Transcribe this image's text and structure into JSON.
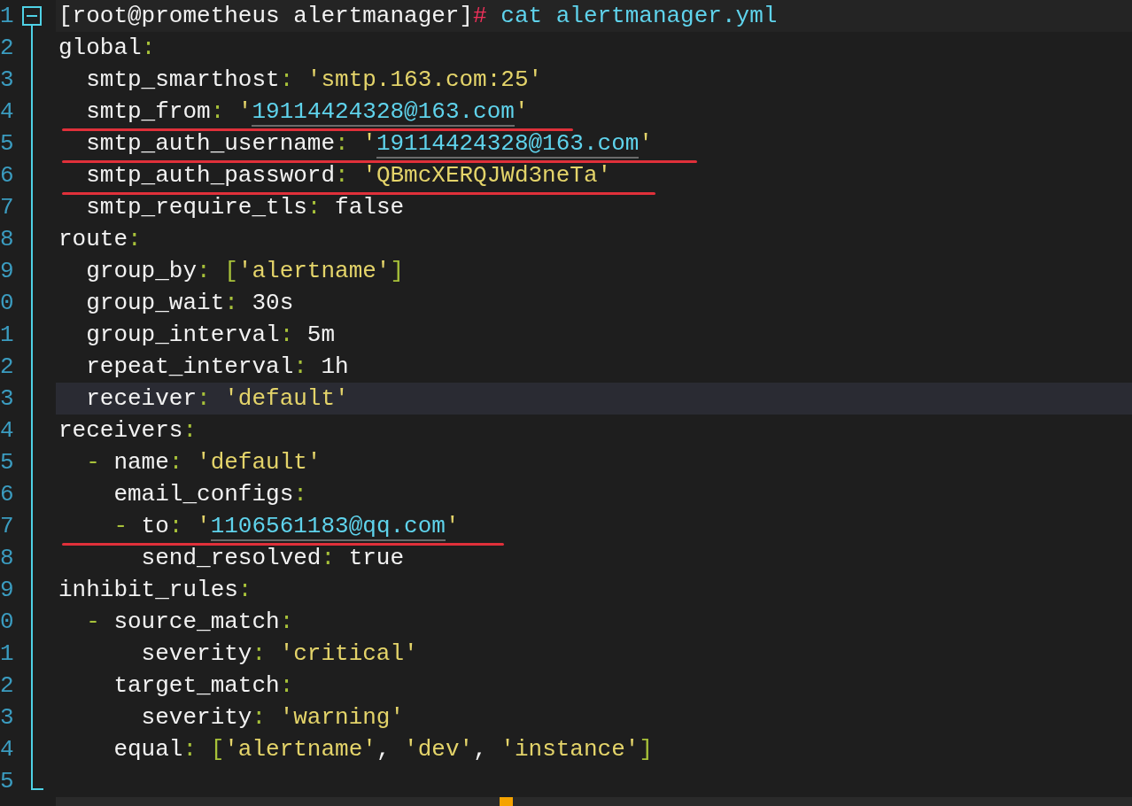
{
  "editor": {
    "lines": [
      {
        "number": "1",
        "highlighted": false,
        "underlined": false,
        "tokens": [
          {
            "kind": "text",
            "text": "[root@prometheus alertmanager]"
          },
          {
            "kind": "hash",
            "text": "#"
          },
          {
            "kind": "cmd",
            "text": " cat alertmanager.yml"
          }
        ]
      },
      {
        "number": "2",
        "highlighted": false,
        "underlined": false,
        "tokens": [
          {
            "kind": "text",
            "text": "global"
          },
          {
            "kind": "punct",
            "text": ":"
          }
        ]
      },
      {
        "number": "3",
        "highlighted": false,
        "underlined": false,
        "tokens": [
          {
            "kind": "text",
            "text": "  smtp_smarthost"
          },
          {
            "kind": "punct",
            "text": ":"
          },
          {
            "kind": "string",
            "text": " 'smtp.163.com:25'"
          }
        ]
      },
      {
        "number": "4",
        "highlighted": false,
        "underlined": true,
        "tokens": [
          {
            "kind": "text",
            "text": "  smtp_from"
          },
          {
            "kind": "punct",
            "text": ":"
          },
          {
            "kind": "string",
            "text": " '"
          },
          {
            "kind": "link",
            "text": "19114424328@163.com"
          },
          {
            "kind": "string",
            "text": "'"
          }
        ]
      },
      {
        "number": "5",
        "highlighted": false,
        "underlined": true,
        "tokens": [
          {
            "kind": "text",
            "text": "  smtp_auth_username"
          },
          {
            "kind": "punct",
            "text": ":"
          },
          {
            "kind": "string",
            "text": " '"
          },
          {
            "kind": "link",
            "text": "19114424328@163.com"
          },
          {
            "kind": "string",
            "text": "'"
          }
        ]
      },
      {
        "number": "6",
        "highlighted": false,
        "underlined": true,
        "tokens": [
          {
            "kind": "text",
            "text": "  smtp_auth_password"
          },
          {
            "kind": "punct",
            "text": ":"
          },
          {
            "kind": "string",
            "text": " 'QBmcXERQJWd3neTa'"
          }
        ]
      },
      {
        "number": "7",
        "highlighted": false,
        "underlined": false,
        "tokens": [
          {
            "kind": "text",
            "text": "  smtp_require_tls"
          },
          {
            "kind": "punct",
            "text": ":"
          },
          {
            "kind": "text",
            "text": " false"
          }
        ]
      },
      {
        "number": "8",
        "highlighted": false,
        "underlined": false,
        "tokens": [
          {
            "kind": "text",
            "text": "route"
          },
          {
            "kind": "punct",
            "text": ":"
          }
        ]
      },
      {
        "number": "9",
        "highlighted": false,
        "underlined": false,
        "tokens": [
          {
            "kind": "text",
            "text": "  group_by"
          },
          {
            "kind": "punct",
            "text": ": ["
          },
          {
            "kind": "string",
            "text": "'alertname'"
          },
          {
            "kind": "punct",
            "text": "]"
          }
        ]
      },
      {
        "number": "0",
        "highlighted": false,
        "underlined": false,
        "tokens": [
          {
            "kind": "text",
            "text": "  group_wait"
          },
          {
            "kind": "punct",
            "text": ":"
          },
          {
            "kind": "text",
            "text": " 30s"
          }
        ]
      },
      {
        "number": "1",
        "highlighted": false,
        "underlined": false,
        "tokens": [
          {
            "kind": "text",
            "text": "  group_interval"
          },
          {
            "kind": "punct",
            "text": ":"
          },
          {
            "kind": "text",
            "text": " 5m"
          }
        ]
      },
      {
        "number": "2",
        "highlighted": false,
        "underlined": false,
        "tokens": [
          {
            "kind": "text",
            "text": "  repeat_interval"
          },
          {
            "kind": "punct",
            "text": ":"
          },
          {
            "kind": "text",
            "text": " 1h"
          }
        ]
      },
      {
        "number": "3",
        "highlighted": true,
        "underlined": false,
        "tokens": [
          {
            "kind": "text",
            "text": "  receiver"
          },
          {
            "kind": "punct",
            "text": ":"
          },
          {
            "kind": "string",
            "text": " 'default'"
          }
        ]
      },
      {
        "number": "4",
        "highlighted": false,
        "underlined": false,
        "tokens": [
          {
            "kind": "text",
            "text": "receivers"
          },
          {
            "kind": "punct",
            "text": ":"
          }
        ]
      },
      {
        "number": "5",
        "highlighted": false,
        "underlined": false,
        "tokens": [
          {
            "kind": "punct",
            "text": "  -"
          },
          {
            "kind": "text",
            "text": " name"
          },
          {
            "kind": "punct",
            "text": ":"
          },
          {
            "kind": "string",
            "text": " 'default'"
          }
        ]
      },
      {
        "number": "6",
        "highlighted": false,
        "underlined": false,
        "tokens": [
          {
            "kind": "text",
            "text": "    email_configs"
          },
          {
            "kind": "punct",
            "text": ":"
          }
        ]
      },
      {
        "number": "7",
        "highlighted": false,
        "underlined": true,
        "tokens": [
          {
            "kind": "punct",
            "text": "    -"
          },
          {
            "kind": "text",
            "text": " to"
          },
          {
            "kind": "punct",
            "text": ":"
          },
          {
            "kind": "string",
            "text": " '"
          },
          {
            "kind": "link",
            "text": "1106561183@qq.com"
          },
          {
            "kind": "string",
            "text": "'"
          }
        ]
      },
      {
        "number": "8",
        "highlighted": false,
        "underlined": false,
        "tokens": [
          {
            "kind": "text",
            "text": "      send_resolved"
          },
          {
            "kind": "punct",
            "text": ":"
          },
          {
            "kind": "text",
            "text": " true"
          }
        ]
      },
      {
        "number": "9",
        "highlighted": false,
        "underlined": false,
        "tokens": [
          {
            "kind": "text",
            "text": "inhibit_rules"
          },
          {
            "kind": "punct",
            "text": ":"
          }
        ]
      },
      {
        "number": "0",
        "highlighted": false,
        "underlined": false,
        "tokens": [
          {
            "kind": "punct",
            "text": "  -"
          },
          {
            "kind": "text",
            "text": " source_match"
          },
          {
            "kind": "punct",
            "text": ":"
          }
        ]
      },
      {
        "number": "1",
        "highlighted": false,
        "underlined": false,
        "tokens": [
          {
            "kind": "text",
            "text": "      severity"
          },
          {
            "kind": "punct",
            "text": ":"
          },
          {
            "kind": "string",
            "text": " 'critical'"
          }
        ]
      },
      {
        "number": "2",
        "highlighted": false,
        "underlined": false,
        "tokens": [
          {
            "kind": "text",
            "text": "    target_match"
          },
          {
            "kind": "punct",
            "text": ":"
          }
        ]
      },
      {
        "number": "3",
        "highlighted": false,
        "underlined": false,
        "tokens": [
          {
            "kind": "text",
            "text": "      severity"
          },
          {
            "kind": "punct",
            "text": ":"
          },
          {
            "kind": "string",
            "text": " 'warning'"
          }
        ]
      },
      {
        "number": "4",
        "highlighted": false,
        "underlined": false,
        "tokens": [
          {
            "kind": "text",
            "text": "    equal"
          },
          {
            "kind": "punct",
            "text": ": ["
          },
          {
            "kind": "string",
            "text": "'alertname'"
          },
          {
            "kind": "text",
            "text": ", "
          },
          {
            "kind": "string",
            "text": "'dev'"
          },
          {
            "kind": "text",
            "text": ", "
          },
          {
            "kind": "string",
            "text": "'instance'"
          },
          {
            "kind": "punct",
            "text": "]"
          }
        ]
      },
      {
        "number": "5",
        "highlighted": false,
        "underlined": false
      }
    ]
  }
}
